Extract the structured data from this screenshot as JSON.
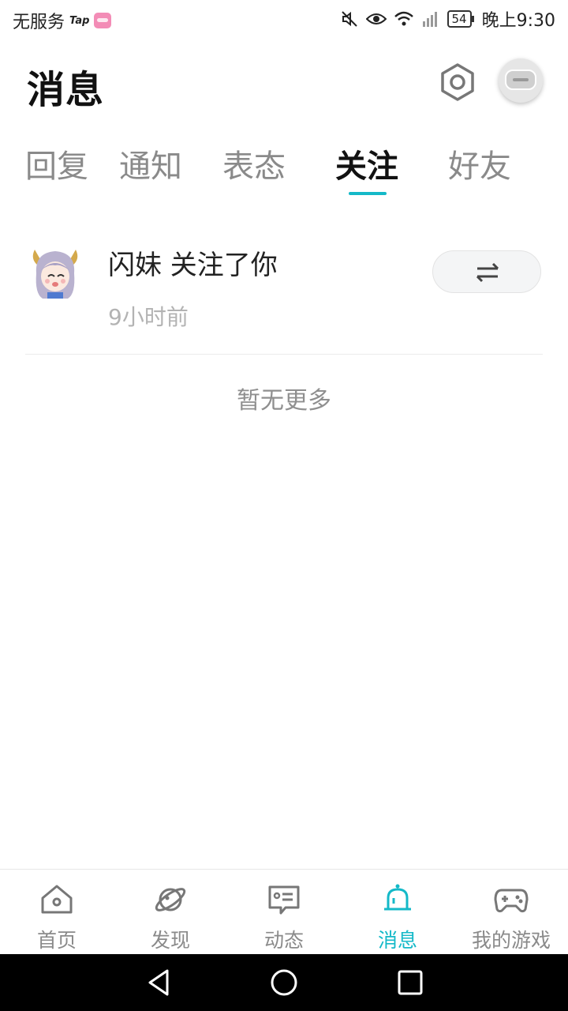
{
  "status_bar": {
    "carrier": "无服务",
    "app_tag": "Tap",
    "battery": "54",
    "time": "晚上9:30"
  },
  "header": {
    "title": "消息",
    "settings_icon": "settings-hexagon-icon",
    "avatar_icon": "user-avatar"
  },
  "tabs": [
    {
      "label": "回复",
      "active": false
    },
    {
      "label": "通知",
      "active": false
    },
    {
      "label": "表态",
      "active": false
    },
    {
      "label": "关注",
      "active": true
    },
    {
      "label": "好友",
      "active": false
    }
  ],
  "follow_list": [
    {
      "text": "闪妹 关注了你",
      "time": "9小时前",
      "action_icon": "mutual-follow-arrows-icon"
    }
  ],
  "empty_hint": "暂无更多",
  "bottom_nav": [
    {
      "label": "首页",
      "icon": "home-icon",
      "active": false
    },
    {
      "label": "发现",
      "icon": "planet-icon",
      "active": false
    },
    {
      "label": "动态",
      "icon": "feed-card-icon",
      "active": false
    },
    {
      "label": "消息",
      "icon": "bell-icon",
      "active": true
    },
    {
      "label": "我的游戏",
      "icon": "gamepad-icon",
      "active": false
    }
  ],
  "colors": {
    "accent": "#14b9c8",
    "inactive_text": "#8a8a8a"
  }
}
